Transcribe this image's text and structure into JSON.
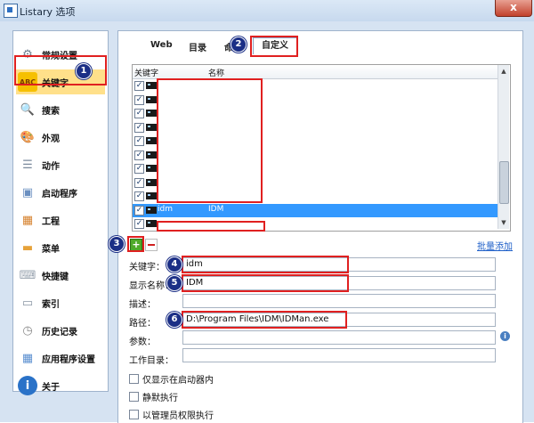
{
  "window": {
    "title": "Listary 选项",
    "close_glyph": "x"
  },
  "sidebar": {
    "items": [
      {
        "label": "常规设置",
        "icon": "gear-icon",
        "glyph": "⚙",
        "color": "#6b7c8e"
      },
      {
        "label": "关键字",
        "icon": "abc-icon",
        "glyph": "ABC",
        "color": "#f0b800",
        "selected": true
      },
      {
        "label": "搜索",
        "icon": "magnifier-icon",
        "glyph": "🔍",
        "color": "#e2a230"
      },
      {
        "label": "外观",
        "icon": "palette-icon",
        "glyph": "🎨",
        "color": "#e07040"
      },
      {
        "label": "动作",
        "icon": "action-list-icon",
        "glyph": "☰",
        "color": "#7a8a9c"
      },
      {
        "label": "启动程序",
        "icon": "launcher-window-icon",
        "glyph": "▣",
        "color": "#6a8fc0"
      },
      {
        "label": "工程",
        "icon": "project-cube-icon",
        "glyph": "▦",
        "color": "#d6822e"
      },
      {
        "label": "菜单",
        "icon": "folder-icon",
        "glyph": "▬",
        "color": "#e6a23a"
      },
      {
        "label": "快捷键",
        "icon": "keyboard-icon",
        "glyph": "⌨",
        "color": "#9aa4b0"
      },
      {
        "label": "索引",
        "icon": "index-icon",
        "glyph": "▭",
        "color": "#8a96a4"
      },
      {
        "label": "历史记录",
        "icon": "clock-icon",
        "glyph": "◷",
        "color": "#8a8a8a"
      },
      {
        "label": "应用程序设置",
        "icon": "app-grid-icon",
        "glyph": "▦",
        "color": "#5b8fd0"
      },
      {
        "label": "关于",
        "icon": "info-icon",
        "glyph": "i",
        "color": "#2a72c8"
      }
    ]
  },
  "tabs": {
    "web": "Web",
    "directory": "目录",
    "command": "命",
    "custom": "自定义"
  },
  "list": {
    "col_keyword": "关键字",
    "col_name": "名称",
    "check_glyph": "✓",
    "rows": [
      {
        "keyword": "",
        "name": ""
      },
      {
        "keyword": "",
        "name": ""
      },
      {
        "keyword": "",
        "name": ""
      },
      {
        "keyword": "",
        "name": ""
      },
      {
        "keyword": "",
        "name": ""
      },
      {
        "keyword": "",
        "name": ""
      },
      {
        "keyword": "",
        "name": ""
      },
      {
        "keyword": "",
        "name": ""
      },
      {
        "keyword": "",
        "name": ""
      },
      {
        "keyword": "idm",
        "name": "IDM",
        "selected": true
      },
      {
        "keyword": "",
        "name": ""
      }
    ],
    "scroll_up_glyph": "▲",
    "scroll_down_glyph": "▼"
  },
  "toolbar": {
    "add_glyph": "+",
    "batch_add": "批量添加"
  },
  "form": {
    "keyword_label": "关键字：",
    "keyword_value": "idm",
    "display_name_label": "显示名称：",
    "display_name_value": "IDM",
    "description_label": "描述：",
    "description_value": "",
    "path_label": "路径：",
    "path_value": "D:\\Program Files\\IDM\\IDMan.exe",
    "params_label": "参数：",
    "params_value": "",
    "workdir_label": "工作目录：",
    "workdir_value": "",
    "info_glyph": "i"
  },
  "options": {
    "launcher_only": "仅显示在启动器内",
    "silent": "静默执行",
    "run_as_admin": "以管理员权限执行"
  },
  "annotations": {
    "b1": "1",
    "b2": "2",
    "b3": "3",
    "b4": "4",
    "b5": "5",
    "b6": "6"
  }
}
